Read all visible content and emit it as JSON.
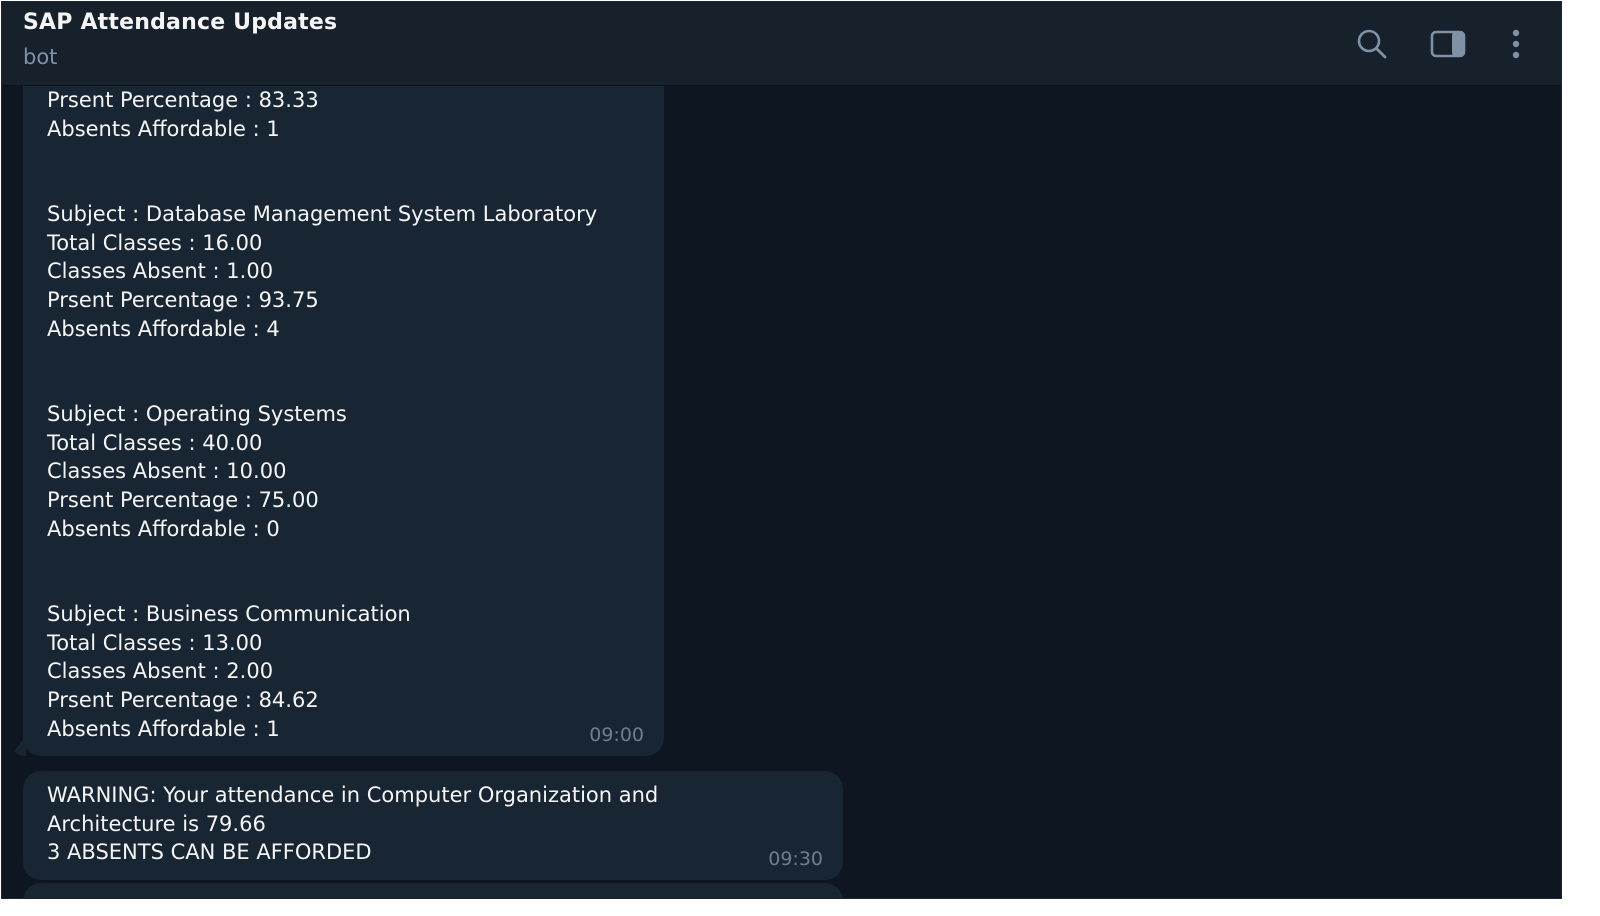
{
  "header": {
    "title": "SAP Attendance Updates",
    "subtitle": "bot",
    "icons": [
      "search-icon",
      "sidebar-toggle-icon",
      "more-vertical-icon"
    ]
  },
  "messages": [
    {
      "lines": [
        "Prsent Percentage : 83.33",
        "Absents Affordable : 1",
        "",
        "Subject : Database Management System Laboratory",
        "Total Classes : 16.00",
        "Classes Absent : 1.00",
        "Prsent Percentage : 93.75",
        "Absents Affordable : 4",
        "",
        "Subject : Operating Systems",
        "Total Classes : 40.00",
        "Classes Absent : 10.00",
        "Prsent Percentage : 75.00",
        "Absents Affordable : 0",
        "",
        "Subject : Business Communication",
        "Total Classes : 13.00",
        "Classes Absent : 2.00",
        "Prsent Percentage : 84.62",
        "Absents Affordable : 1"
      ],
      "time": "09:00"
    },
    {
      "lines": [
        "WARNING: Your attendance in Computer Organization and",
        "Architecture is 79.66",
        "3 ABSENTS CAN BE AFFORDED"
      ],
      "time": "09:30"
    }
  ],
  "colors": {
    "background": "#0e1621",
    "header": "#17212b",
    "bubble": "#182533",
    "text": "#f5f5f5",
    "muted": "#7f91a4"
  }
}
